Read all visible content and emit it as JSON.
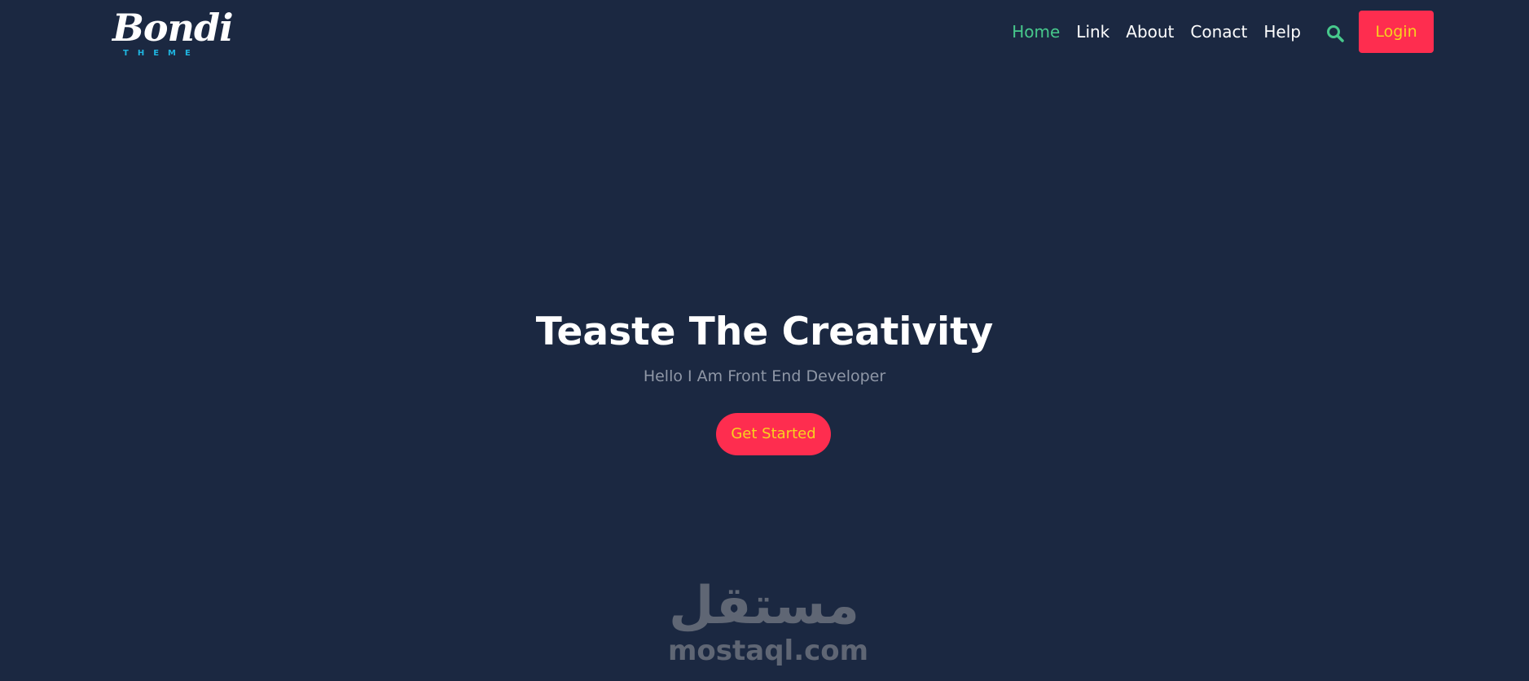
{
  "header": {
    "logo": {
      "script_text": "Bondi",
      "sub_text": "THEME"
    },
    "nav": [
      {
        "label": "Home",
        "active": true
      },
      {
        "label": "Link",
        "active": false
      },
      {
        "label": "About",
        "active": false
      },
      {
        "label": "Conact",
        "active": false
      },
      {
        "label": "Help",
        "active": false
      }
    ],
    "search_icon": "search-icon",
    "login_label": "Login"
  },
  "hero": {
    "title": "Teaste The Creativity",
    "subtitle": "Hello I Am Front End Developer",
    "cta_label": "Get Started"
  },
  "watermark": {
    "arabic": "مستقل",
    "latin": "mostaql.com"
  },
  "colors": {
    "background": "#1b2841",
    "accent": "#fe2d4f",
    "button_text": "#f8d21e",
    "active_nav": "#47c98c",
    "logo_sub": "#1fb5e0",
    "subtitle": "#8f97a6",
    "watermark": "#5f6674"
  }
}
